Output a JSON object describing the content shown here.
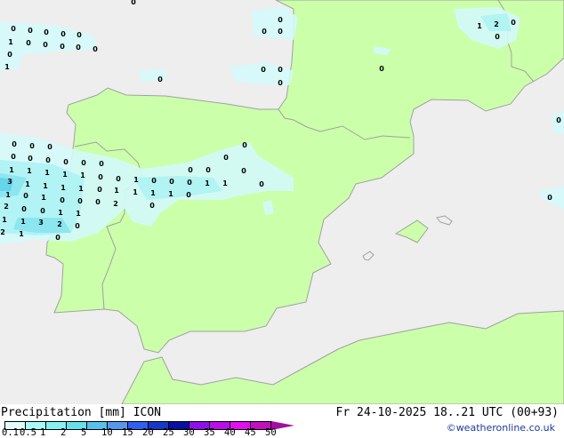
{
  "map": {
    "land_color": "#ccffaa",
    "sea_color": "#eeeeee",
    "border_color": "#a0a0a0",
    "rain_colors": [
      "#d4fafa",
      "#aef2f4",
      "#86e4ee",
      "#62d2e8"
    ],
    "value_labels": [
      "0",
      "0",
      "0",
      "0",
      "0",
      "1",
      "0",
      "0",
      "0",
      "0",
      "0",
      "0",
      "1",
      "0",
      "0",
      "0",
      "0",
      "0",
      "0",
      "0",
      "0",
      "0",
      "1",
      "2",
      "0",
      "0",
      "0",
      "0",
      "0",
      "0",
      "0",
      "0",
      "0",
      "0",
      "0",
      "0",
      "0",
      "1",
      "1",
      "1",
      "1",
      "1",
      "0",
      "0",
      "1",
      "0",
      "0",
      "0",
      "1",
      "1",
      "0",
      "0",
      "0",
      "0",
      "0",
      "0",
      "3",
      "1",
      "1",
      "1",
      "1",
      "0",
      "1",
      "1",
      "1",
      "1",
      "0",
      "1",
      "0",
      "1",
      "0",
      "0",
      "0",
      "2",
      "0",
      "2",
      "0",
      "0",
      "1",
      "1",
      "1",
      "1",
      "3",
      "2",
      "0",
      "2",
      "1",
      "0"
    ]
  },
  "legend": {
    "title": "Precipitation [mm]  ICON",
    "colors": [
      "#e0fcfc",
      "#a8fafa",
      "#88f0f0",
      "#68e0ec",
      "#58c0ec",
      "#5898ec",
      "#3060f0",
      "#1838c8",
      "#0810a0",
      "#9010e8",
      "#b810e8",
      "#e010f0",
      "#c010c0"
    ],
    "arrow_color": "#a010a0",
    "ticks": [
      "0.1",
      "0.5",
      "1",
      "2",
      "5",
      "10",
      "15",
      "20",
      "25",
      "30",
      "35",
      "40",
      "45",
      "50"
    ]
  },
  "header": {
    "valid_time": "Fr 24-10-2025 18..21 UTC (00+93)",
    "credit": "©weatheronline.co.uk"
  }
}
